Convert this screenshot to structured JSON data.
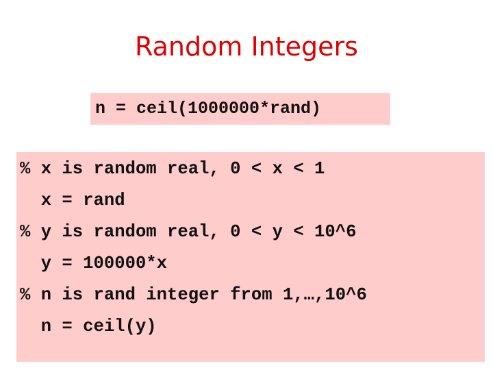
{
  "slide": {
    "title": "Random Integers",
    "formula": "n = ceil(1000000*rand)",
    "code_lines": [
      "% x is random real, 0 < x < 1",
      "  x = rand",
      "% y is random real, 0 < y < 10^6",
      "  y = 100000*x",
      "% n is rand integer from 1,…,10^6",
      "  n = ceil(y)"
    ],
    "colors": {
      "title": "#e00000",
      "box_background": "#ffcccc",
      "text": "#111111"
    }
  }
}
